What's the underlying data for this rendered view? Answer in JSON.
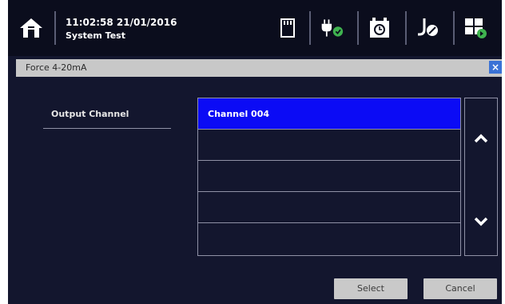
{
  "header": {
    "time": "11:02:58",
    "date": "21/01/2016",
    "subtitle": "System Test"
  },
  "icons": [
    "home-icon",
    "sd-card-icon",
    "power-plug-icon",
    "alarm-clock-icon",
    "calibration-icon",
    "screen-icon"
  ],
  "dialog": {
    "title": "Force 4-20mA",
    "close_label": "×",
    "field_label": "Output Channel",
    "list": [
      "Channel 004",
      "",
      "",
      "",
      ""
    ],
    "selected_index": 0,
    "buttons": {
      "select": "Select",
      "cancel": "Cancel"
    }
  },
  "colors": {
    "background": "#13162e",
    "topbar": "#0b0d1d",
    "selection": "#0b0bf5",
    "accent_green": "#3fb34f",
    "title_bar": "#c8c8c8"
  }
}
